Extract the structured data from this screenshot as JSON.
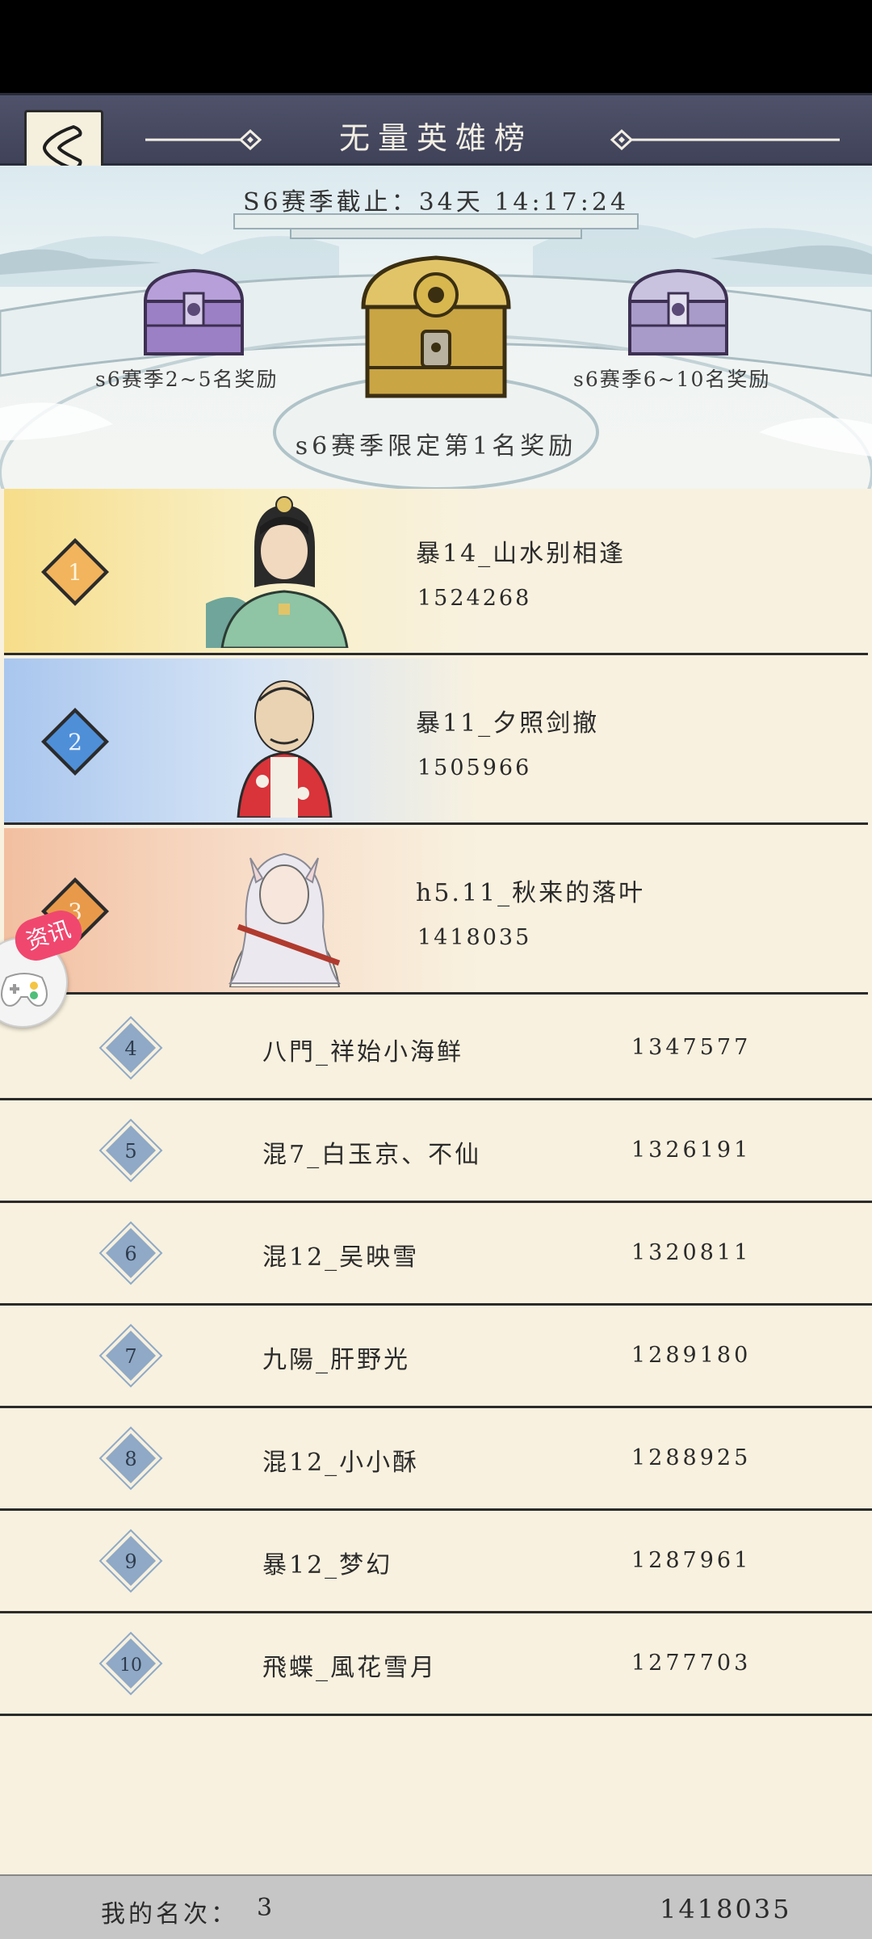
{
  "header": {
    "title": "无量英雄榜"
  },
  "banner": {
    "season_timer": "S6赛季截止：34天 14:17:24",
    "reward_2_5": "s6赛季2~5名奖励",
    "reward_6_10": "s6赛季6~10名奖励",
    "reward_1": "s6赛季限定第1名奖励"
  },
  "rankings": [
    {
      "rank": "1",
      "name": "暴14_山水别相逢",
      "score": "1524268"
    },
    {
      "rank": "2",
      "name": "暴11_夕照剑撤",
      "score": "1505966"
    },
    {
      "rank": "3",
      "name": "h5.11_秋来的落叶",
      "score": "1418035"
    },
    {
      "rank": "4",
      "name": "八門_祥始小海鲜",
      "score": "1347577"
    },
    {
      "rank": "5",
      "name": "混7_白玉京、不仙",
      "score": "1326191"
    },
    {
      "rank": "6",
      "name": "混12_吴映雪",
      "score": "1320811"
    },
    {
      "rank": "7",
      "name": "九陽_肝野光",
      "score": "1289180"
    },
    {
      "rank": "8",
      "name": "混12_小小酥",
      "score": "1288925"
    },
    {
      "rank": "9",
      "name": "暴12_梦幻",
      "score": "1287961"
    },
    {
      "rank": "10",
      "name": "飛蝶_風花雪月",
      "score": "1277703"
    }
  ],
  "my_rank": {
    "label": "我的名次：",
    "value": "3",
    "score": "1418035"
  },
  "widget": {
    "news_label": "资讯"
  },
  "colors": {
    "title_bar": "#4a4d63",
    "list_bg": "#f8f1df",
    "gold": "#f2b45c",
    "blue": "#4f8fd8",
    "bronze": "#e89a4a",
    "silver_badge": "#8fa9c6",
    "news_badge": "#f0476f"
  }
}
